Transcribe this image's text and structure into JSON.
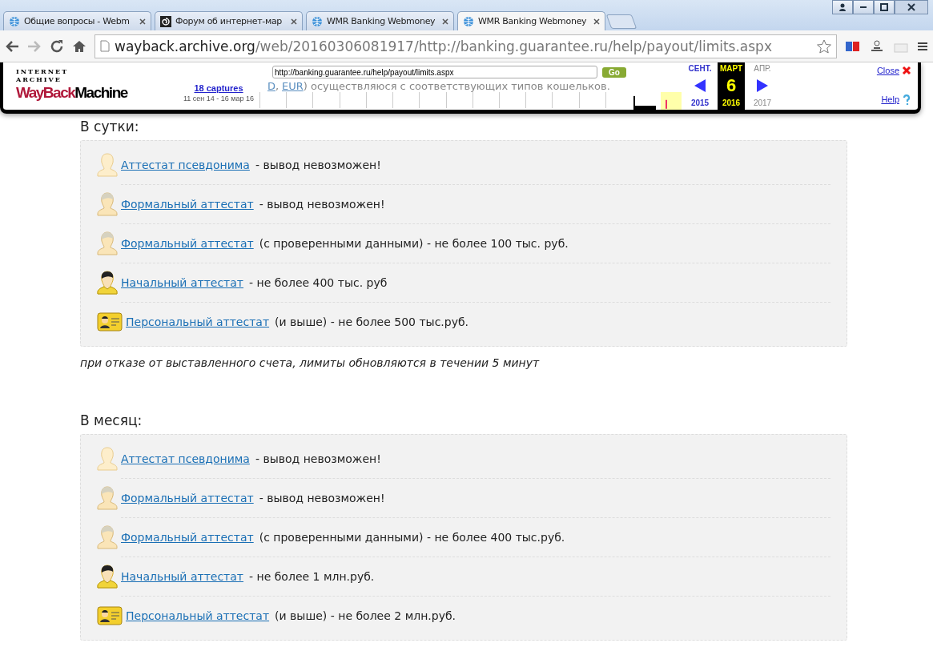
{
  "browser": {
    "tabs": [
      {
        "title": "Общие вопросы - Webm",
        "selected": false
      },
      {
        "title": "Форум об интернет-мар",
        "selected": false
      },
      {
        "title": "WMR Banking Webmoney",
        "selected": false
      },
      {
        "title": "WMR Banking Webmoney",
        "selected": true
      }
    ],
    "address": {
      "host": "wayback.archive.org",
      "path": "/web/20160306081917/http://banking.guarantee.ru/help/payout/limits.aspx"
    }
  },
  "background_text": {
    "parts": [
      {
        "text": "D",
        "link": true
      },
      {
        "text": ",",
        "link": false
      },
      {
        "text": "EUR",
        "link": true
      },
      {
        "text": ") осуществляюся с соответствующих типов кошельков.",
        "link": false
      }
    ]
  },
  "wayback": {
    "logo_top": "INTERNET ARCHIVE",
    "logo_a": "WayBack",
    "logo_b": "Machine",
    "url": "http://banking.guarantee.ru/help/payout/limits.aspx",
    "go": "Go",
    "captures": "18 captures",
    "range": "11 сен 14 - 16 мар 16",
    "months": [
      {
        "kind": "prev",
        "month": "СЕНТ.",
        "year": "2015"
      },
      {
        "kind": "current",
        "month": "МАРТ",
        "day": "6",
        "year": "2016"
      },
      {
        "kind": "next",
        "month": "АПР.",
        "year": "2017"
      }
    ],
    "close": "Close",
    "help": "Help"
  },
  "sections": [
    {
      "heading": "В сутки:",
      "items": [
        {
          "kind": "pseudonym",
          "link": "Аттестат псевдонима",
          "text": "- вывод невозможен!"
        },
        {
          "kind": "formal",
          "link": "Формальный аттестат",
          "text": "- вывод невозможен!"
        },
        {
          "kind": "formal",
          "link": "Формальный аттестат",
          "text": "(с проверенными данными) - не более 100 тыс. руб."
        },
        {
          "kind": "initial",
          "link": "Начальный аттестат",
          "text": "- не более 400 тыс. руб"
        },
        {
          "kind": "personal",
          "link": "Персональный аттестат",
          "text": "(и выше) - не более 500 тыс.руб."
        }
      ],
      "note": "при отказе от выставленного счета, лимиты обновляются в течении 5 минут"
    },
    {
      "heading": "В месяц:",
      "items": [
        {
          "kind": "pseudonym",
          "link": "Аттестат псевдонима",
          "text": "- вывод невозможен!"
        },
        {
          "kind": "formal",
          "link": "Формальный аттестат",
          "text": "- вывод невозможен!"
        },
        {
          "kind": "formal",
          "link": "Формальный аттестат",
          "text": "(с проверенными данными) - не более 400 тыс.руб."
        },
        {
          "kind": "initial",
          "link": "Начальный аттестат",
          "text": "- не более 1 млн.руб."
        },
        {
          "kind": "personal",
          "link": "Персональный аттестат",
          "text": "(и выше) - не более 2 млн.руб."
        }
      ]
    }
  ]
}
